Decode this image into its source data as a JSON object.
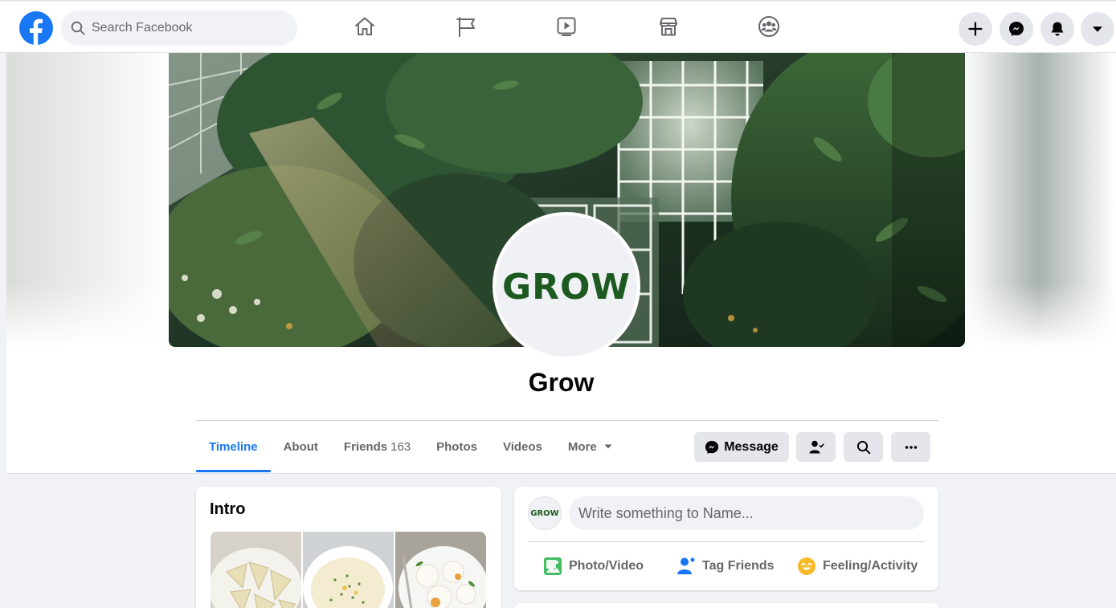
{
  "topbar": {
    "logo_icon": "facebook-logo-icon",
    "search": {
      "placeholder": "Search Facebook",
      "value": ""
    },
    "nav": [
      {
        "id": "home",
        "icon": "home-icon"
      },
      {
        "id": "pages",
        "icon": "flag-icon"
      },
      {
        "id": "watch",
        "icon": "video-play-icon"
      },
      {
        "id": "marketplace",
        "icon": "store-icon"
      },
      {
        "id": "groups",
        "icon": "groups-icon"
      }
    ],
    "actions": [
      {
        "id": "create",
        "icon": "plus-icon"
      },
      {
        "id": "messenger",
        "icon": "messenger-icon"
      },
      {
        "id": "notifications",
        "icon": "bell-icon"
      },
      {
        "id": "account",
        "icon": "caret-down-icon"
      }
    ]
  },
  "profile": {
    "avatar_text": "GROW",
    "name": "Grow",
    "brand_color": "#1d5a20",
    "tabs": [
      {
        "label": "Timeline",
        "active": true
      },
      {
        "label": "About"
      },
      {
        "label": "Friends",
        "count": "163"
      },
      {
        "label": "Photos"
      },
      {
        "label": "Videos"
      },
      {
        "label": "More"
      }
    ],
    "actions": {
      "message_label": "Message",
      "icons": [
        "friend-status-icon",
        "search-icon",
        "more-icon"
      ]
    }
  },
  "intro": {
    "title": "Intro"
  },
  "composer": {
    "avatar_text": "GROW",
    "placeholder": "Write something to Name...",
    "actions": [
      {
        "label": "Photo/Video",
        "icon": "photo-video-icon",
        "color": "#45bd62"
      },
      {
        "label": "Tag Friends",
        "icon": "tag-friends-icon",
        "color": "#1877f2"
      },
      {
        "label": "Feeling/Activity",
        "icon": "feeling-icon",
        "color": "#f7b928"
      }
    ]
  },
  "colors": {
    "accent": "#1877f2",
    "secondary_text": "#65676b",
    "background": "#f0f2f5"
  }
}
